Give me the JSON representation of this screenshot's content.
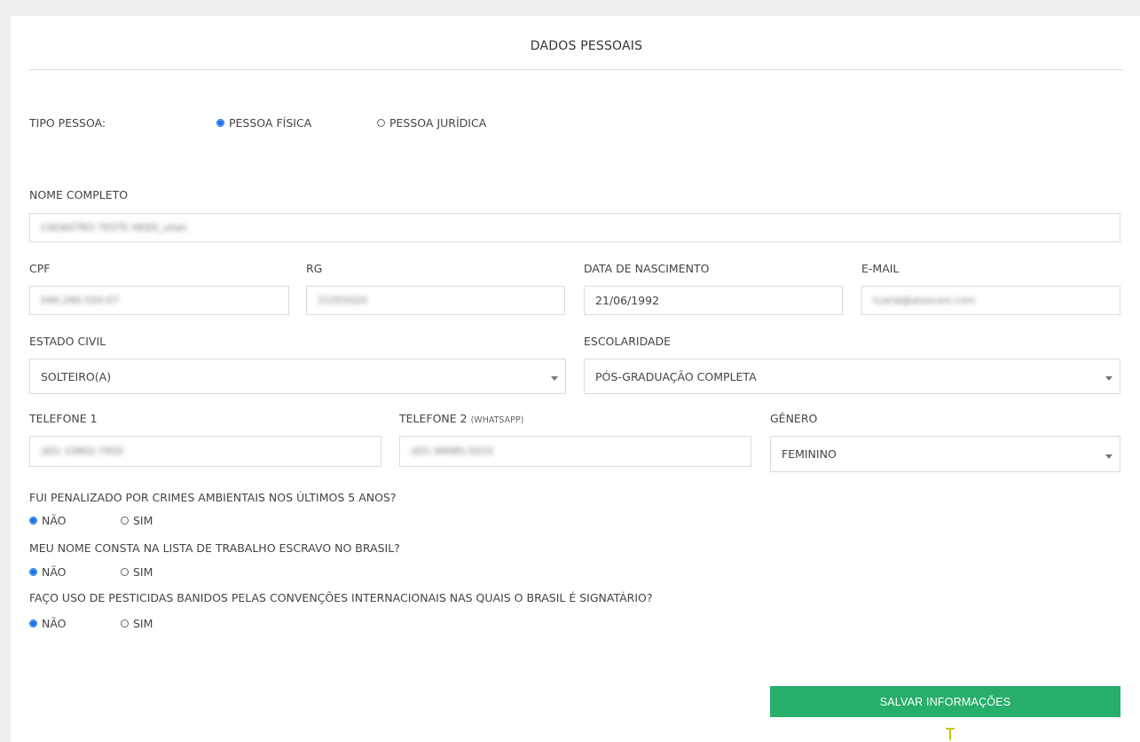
{
  "section": {
    "title": "DADOS PESSOAIS"
  },
  "tipo_pessoa": {
    "label": "TIPO PESSOA:",
    "options": [
      {
        "label": "PESSOA FÍSICA",
        "checked": true
      },
      {
        "label": "PESSOA JURÍDICA",
        "checked": false
      }
    ]
  },
  "nome": {
    "label": "NOME COMPLETO",
    "value": "CADASTRO TESTE HEIDI_ulian"
  },
  "cpf": {
    "label": "CPF",
    "value": "040.280.550-07"
  },
  "rg": {
    "label": "RG",
    "value": "21055020"
  },
  "data_nascimento": {
    "label": "DATA DE NASCIMENTO",
    "value": "21/06/1992"
  },
  "email": {
    "label": "E-MAIL",
    "value": "tcarla@alsocom.com"
  },
  "estado_civil": {
    "label": "ESTADO CIVIL",
    "value": "SOLTEIRO(A)"
  },
  "escolaridade": {
    "label": "ESCOLARIDADE",
    "value": "PÓS-GRADUAÇÃO COMPLETA"
  },
  "telefone1": {
    "label": "TELEFONE 1",
    "value": "(65) 33802-7950"
  },
  "telefone2": {
    "label": "TELEFONE 2",
    "label_suffix": "(WHATSAPP)",
    "value": "(65) 99985-5033"
  },
  "genero": {
    "label": "GÊNERO",
    "value": "FEMININO"
  },
  "questions": [
    {
      "text": "FUI PENALIZADO POR CRIMES AMBIENTAIS NOS ÚLTIMOS 5 ANOS?",
      "options": [
        {
          "label": "NÃO",
          "checked": true
        },
        {
          "label": "SIM",
          "checked": false
        }
      ]
    },
    {
      "text": "MEU NOME CONSTA NA LISTA DE TRABALHO ESCRAVO NO BRASIL?",
      "options": [
        {
          "label": "NÃO",
          "checked": true
        },
        {
          "label": "SIM",
          "checked": false
        }
      ]
    },
    {
      "text": "FAÇO USO DE PESTICIDAS BANIDOS PELAS CONVENÇÕES INTERNACIONAIS NAS QUAIS O BRASIL É SIGNATÁRIO?",
      "options": [
        {
          "label": "NÃO",
          "checked": true
        },
        {
          "label": "SIM",
          "checked": false
        }
      ]
    }
  ],
  "actions": {
    "save_label": "SALVAR INFORMAÇÕES"
  },
  "colors": {
    "accent_blue": "#1a73e8",
    "save_green": "#27ae6a"
  }
}
